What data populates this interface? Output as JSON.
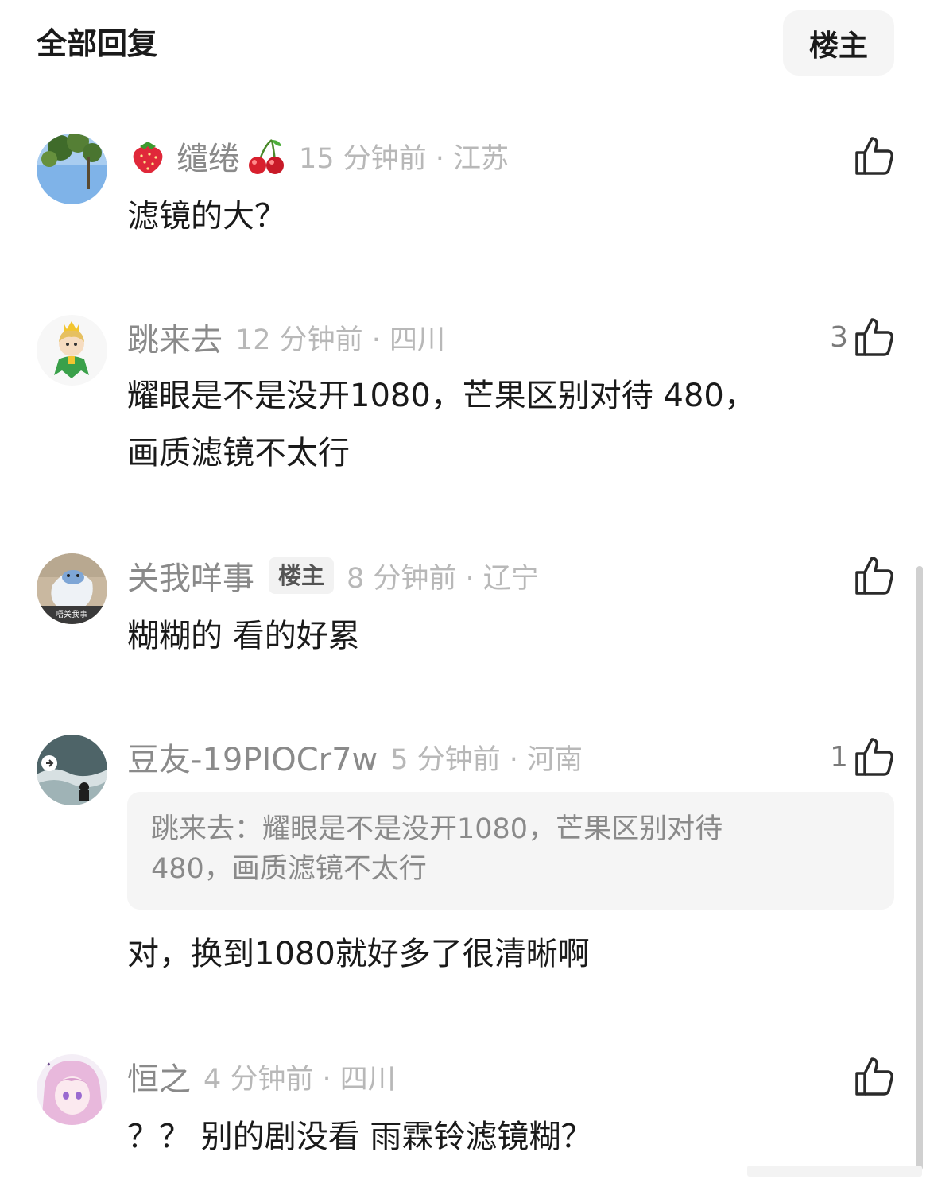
{
  "header": {
    "title": "全部回复",
    "filter_label": "楼主"
  },
  "comments": [
    {
      "username": "缱绻",
      "prefix_emoji": "strawberry-emoji",
      "suffix_emoji": "cherry-emoji",
      "time_location": "15 分钟前 · 江苏",
      "likes": "",
      "content": "滤镜的大？"
    },
    {
      "username": "跳来去",
      "time_location": "12 分钟前 · 四川",
      "likes": "3",
      "content_lines": [
        "耀眼是不是没开1080，芒果区别对待 480，",
        "画质滤镜不太行"
      ]
    },
    {
      "username": "关我咩事",
      "badge": "楼主",
      "time_location": "8 分钟前 · 辽宁",
      "likes": "",
      "content": "糊糊的 看的好累"
    },
    {
      "username": "豆友-19PIOCr7w",
      "time_location": "5 分钟前 · 河南",
      "likes": "1",
      "quote_lines": [
        "跳来去：耀眼是不是没开1080，芒果区别对待",
        "480，画质滤镜不太行"
      ],
      "content": "对，换到1080就好多了很清晰啊"
    },
    {
      "username": "恒之",
      "time_location": "4 分钟前 · 四川",
      "likes": "",
      "content": "？？ 别的剧没看 雨霖铃滤镜糊？"
    }
  ],
  "icons": {
    "like": "thumbs-up-icon"
  },
  "colors": {
    "username": "#8a8a8a",
    "meta": "#b8b8b8",
    "text": "#1a1a1a",
    "quote_bg": "#f5f5f5"
  }
}
